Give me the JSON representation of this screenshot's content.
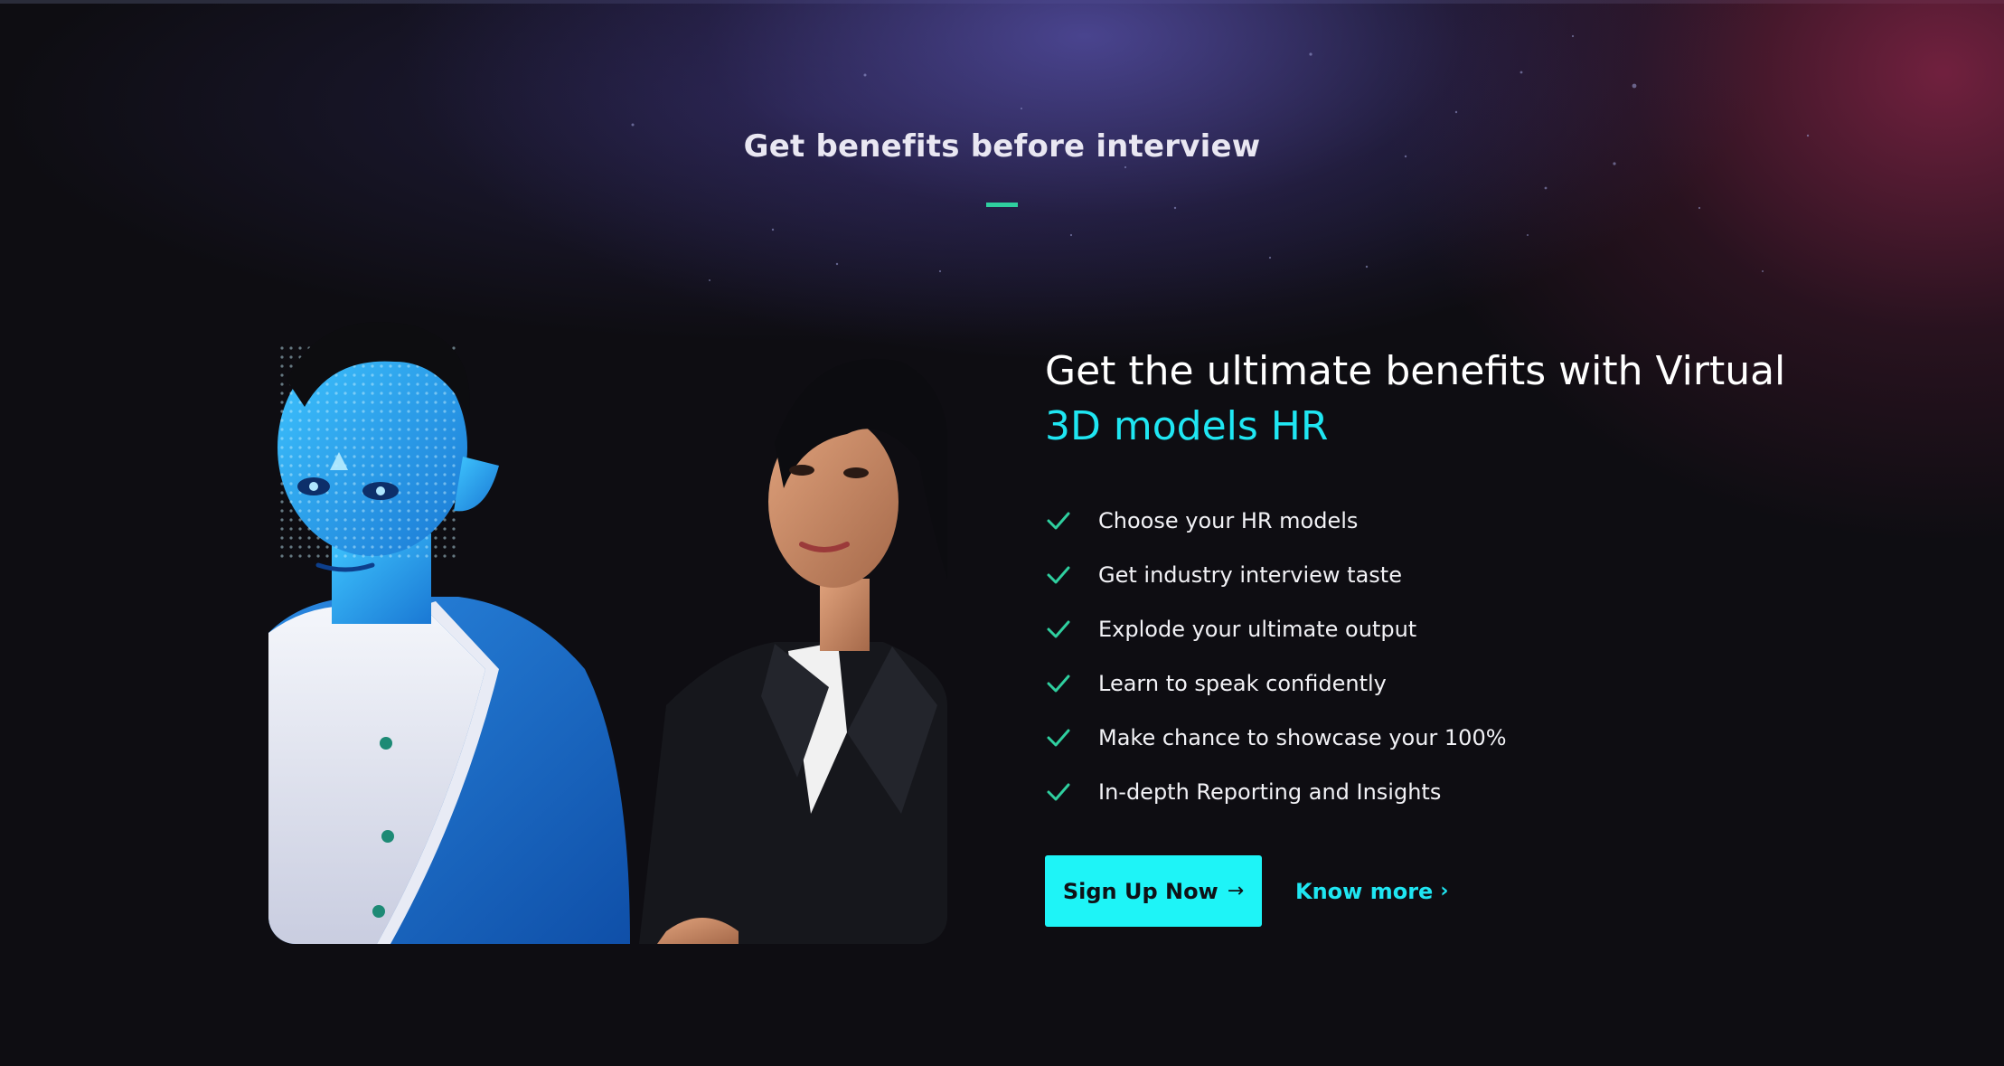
{
  "section": {
    "title": "Get benefits before interview"
  },
  "hero": {
    "headline_line1": "Get the ultimate benefits with Virtual",
    "headline_accent": "3D models HR",
    "features": [
      "Choose your HR models",
      "Get industry interview taste",
      "Explode your ultimate output",
      "Learn to speak confidently",
      "Make chance to showcase your 100%",
      "In-depth Reporting and Insights"
    ],
    "primary_button": "Sign Up Now",
    "primary_button_icon": "→",
    "secondary_link": "Know more",
    "secondary_link_icon": "›"
  },
  "icons": {
    "feature_check": "check-icon",
    "button_arrow": "arrow-right-icon",
    "link_chevron": "chevron-right-icon"
  },
  "colors": {
    "background": "#0e0d12",
    "accent_cyan": "#1fe6f2",
    "button_cyan": "#1ef4f7",
    "check_green": "#2fcf9f",
    "glow_purple": "#524ca0",
    "glow_crimson": "#822446"
  }
}
